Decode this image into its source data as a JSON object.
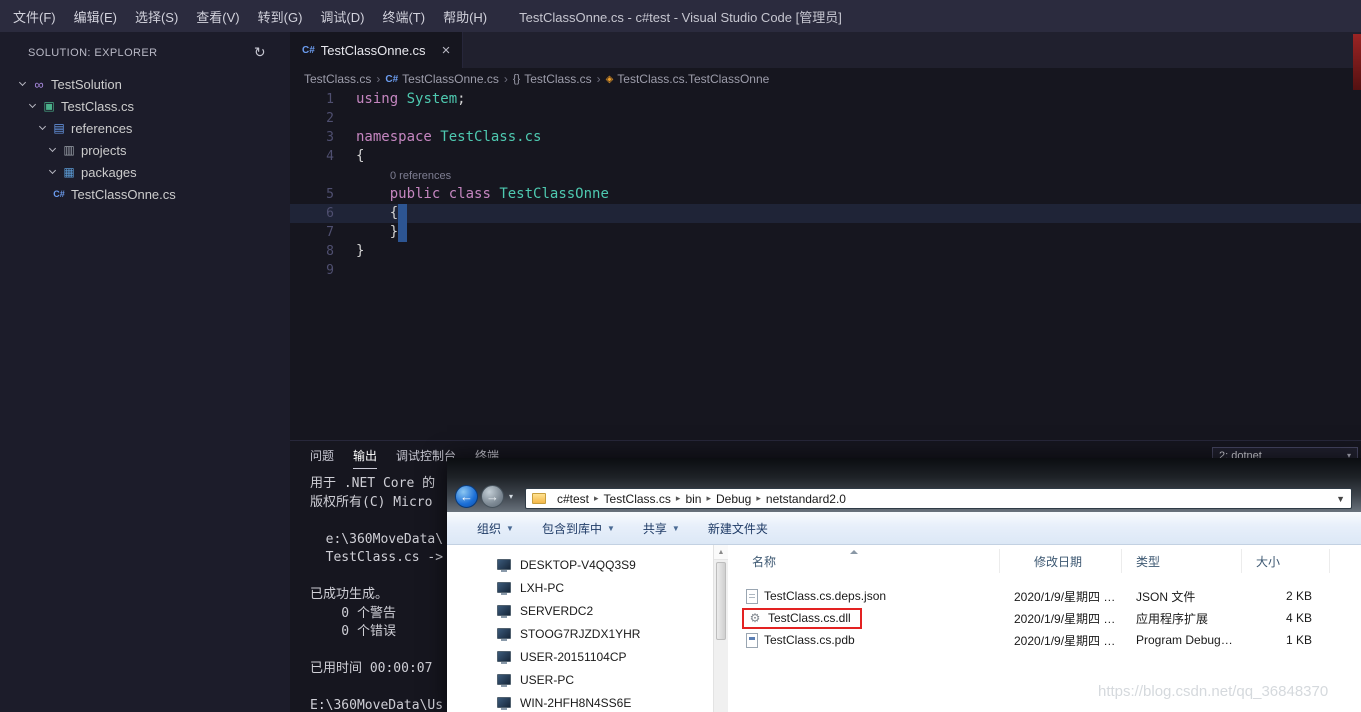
{
  "titlebar": {
    "menus": [
      "文件(F)",
      "编辑(E)",
      "选择(S)",
      "查看(V)",
      "转到(G)",
      "调试(D)",
      "终端(T)",
      "帮助(H)"
    ],
    "title": "TestClassOnne.cs - c#test - Visual Studio Code [管理员]"
  },
  "sidebar": {
    "header": "SOLUTION: EXPLORER",
    "tree": [
      {
        "label": "TestSolution",
        "indent": 0,
        "chevron": true,
        "icon": "solution"
      },
      {
        "label": "TestClass.cs",
        "indent": 1,
        "chevron": true,
        "icon": "project"
      },
      {
        "label": "references",
        "indent": 2,
        "chevron": true,
        "icon": "references"
      },
      {
        "label": "projects",
        "indent": 3,
        "chevron": true,
        "icon": "projects"
      },
      {
        "label": "packages",
        "indent": 3,
        "chevron": true,
        "icon": "packages"
      },
      {
        "label": "TestClassOnne.cs",
        "indent": 2,
        "chevron": false,
        "icon": "csharp"
      }
    ]
  },
  "editor": {
    "tab_label": "TestClassOnne.cs",
    "breadcrumb": [
      {
        "label": "TestClass.cs",
        "icon": ""
      },
      {
        "label": "TestClassOnne.cs",
        "icon": "csharp"
      },
      {
        "label": "TestClass.cs",
        "icon": "braces"
      },
      {
        "label": "TestClass.cs.TestClassOnne",
        "icon": "class_symbol"
      }
    ],
    "code_lines": [
      {
        "num": "1",
        "segs": [
          [
            "using",
            "kw"
          ],
          [
            " ",
            "pl"
          ],
          [
            "System",
            "ty"
          ],
          [
            ";",
            "pl"
          ]
        ]
      },
      {
        "num": "2",
        "segs": []
      },
      {
        "num": "3",
        "segs": [
          [
            "namespace",
            "kw"
          ],
          [
            " ",
            "pl"
          ],
          [
            "TestClass.cs",
            "ty"
          ]
        ]
      },
      {
        "num": "4",
        "segs": [
          [
            "{",
            "pl"
          ]
        ]
      },
      {
        "num": "",
        "segs": [
          [
            "0 references",
            "lens"
          ]
        ]
      },
      {
        "num": "5",
        "segs": [
          [
            "    ",
            "pl"
          ],
          [
            "public",
            "kw"
          ],
          [
            " ",
            "pl"
          ],
          [
            "class",
            "kw"
          ],
          [
            " ",
            "pl"
          ],
          [
            "TestClassOnne",
            "ty"
          ]
        ]
      },
      {
        "num": "6",
        "segs": [
          [
            "    {",
            "pl"
          ]
        ],
        "highlight": true,
        "selblock": true
      },
      {
        "num": "7",
        "segs": [
          [
            "    }",
            "pl"
          ]
        ],
        "selblock": true
      },
      {
        "num": "8",
        "segs": [
          [
            "}",
            "pl"
          ]
        ]
      },
      {
        "num": "9",
        "segs": []
      }
    ]
  },
  "panel": {
    "tabs": [
      {
        "label": "问题",
        "active": false
      },
      {
        "label": "输出",
        "active": true
      },
      {
        "label": "调试控制台",
        "active": false
      },
      {
        "label": "终端",
        "active": false
      }
    ],
    "channel": "2: dotnet",
    "output_lines": [
      "用于 .NET Core 的",
      "版权所有(C) Micro",
      "",
      "  e:\\360MoveData\\",
      "  TestClass.cs ->",
      "",
      "已成功生成。",
      "    0 个警告",
      "    0 个错误",
      "",
      "已用时间 00:00:07",
      "",
      "E:\\360MoveData\\Us"
    ]
  },
  "win_explorer": {
    "breadcrumb": [
      "c#test",
      "TestClass.cs",
      "bin",
      "Debug",
      "netstandard2.0"
    ],
    "toolbar": [
      {
        "label": "组织",
        "caret": true
      },
      {
        "label": "包含到库中",
        "caret": true
      },
      {
        "label": "共享",
        "caret": true
      },
      {
        "label": "新建文件夹",
        "caret": false
      }
    ],
    "nav_items": [
      "DESKTOP-V4QQ3S9",
      "LXH-PC",
      "SERVERDC2",
      "STOOG7RJZDX1YHR",
      "USER-20151104CP",
      "USER-PC",
      "WIN-2HFH8N4SS6E"
    ],
    "columns": [
      "名称",
      "修改日期",
      "类型",
      "大小"
    ],
    "files": [
      {
        "name": "TestClass.cs.deps.json",
        "date": "2020/1/9/星期四 …",
        "type": "JSON 文件",
        "size": "2 KB",
        "icon": "json",
        "highlighted": false
      },
      {
        "name": "TestClass.cs.dll",
        "date": "2020/1/9/星期四 …",
        "type": "应用程序扩展",
        "size": "4 KB",
        "icon": "dll",
        "highlighted": true
      },
      {
        "name": "TestClass.cs.pdb",
        "date": "2020/1/9/星期四 …",
        "type": "Program Debug…",
        "size": "1 KB",
        "icon": "pdb",
        "highlighted": false
      }
    ]
  },
  "watermark": "https://blog.csdn.net/qq_36848370",
  "colors": {
    "keyword": "#c586c0",
    "type": "#4ec9b0",
    "selection": "#2d5592",
    "red_box": "#e32222"
  },
  "icons": {
    "refresh": "↻",
    "close": "×",
    "chevron_right": "›",
    "breadcrumb_arrow": "▸",
    "caret_down": "▼",
    "caret_small": "▾",
    "back_arrow": "←",
    "forward_arrow": "→",
    "scroll_up": "▲",
    "gear": "⚙",
    "braces": "{}",
    "csharp": "C#",
    "class_symbol": "◈",
    "solution": "∞",
    "project": "▣",
    "references": "▤",
    "projects": "▥",
    "packages": "▦"
  }
}
